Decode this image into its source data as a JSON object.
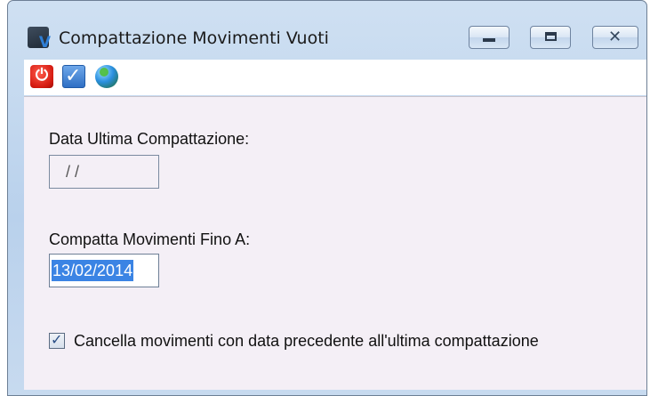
{
  "window": {
    "title": "Compattazione Movimenti Vuoti",
    "app_icon_letter": "V"
  },
  "titlebar_controls": {
    "minimize_icon": "minimize-icon",
    "maximize_icon": "maximize-icon",
    "close_icon": "close-icon",
    "close_glyph": "✕"
  },
  "toolbar": {
    "items": [
      {
        "name": "power-icon",
        "glyph": "⏻",
        "color": "#d41a10"
      },
      {
        "name": "confirm-checkbox-icon",
        "glyph": "✓",
        "color": "#2f6fc4"
      },
      {
        "name": "globe-icon",
        "glyph": "",
        "color": "#2a8fe0"
      }
    ]
  },
  "form": {
    "last_compaction_label": "Data Ultima Compattazione:",
    "last_compaction_value": "/ /",
    "compact_until_label": "Compatta Movimenti Fino A:",
    "compact_until_value": "13/02/2014",
    "delete_checkbox_label": "Cancella movimenti con data precedente all'ultima compattazione",
    "delete_checkbox_checked": true,
    "check_glyph": "✓"
  },
  "colors": {
    "content_bg": "#f4eff6",
    "selection": "#3b84e4"
  }
}
